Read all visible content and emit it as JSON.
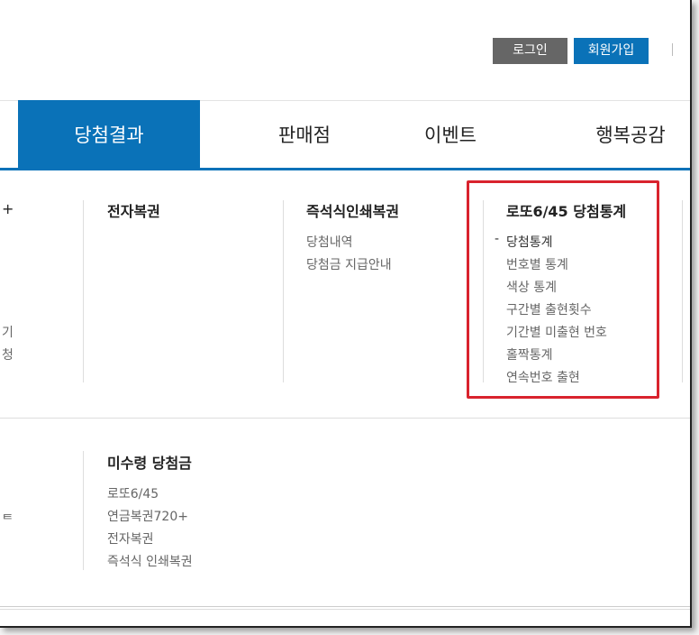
{
  "header": {
    "login_label": "로그인",
    "signup_label": "회원가입"
  },
  "nav": {
    "items": [
      "당첨결과",
      "판매점",
      "이벤트",
      "행복공감"
    ]
  },
  "menu": {
    "col_electronic": {
      "heading": "전자복권"
    },
    "col_instant": {
      "heading": "즉석식인쇄복권",
      "items": [
        "당첨내역",
        "당첨금 지급안내"
      ]
    },
    "col_stats": {
      "heading": "로또6/45 당첨통계",
      "dash": "-",
      "items": [
        "당첨통계",
        "번호별 통계",
        "색상 통계",
        "구간별 출현횟수",
        "기간별 미출현 번호",
        "홀짝통계",
        "연속번호 출현"
      ]
    },
    "col_minor": {
      "heading": "미수령 당첨금",
      "items": [
        "로또6/45",
        "연금복권720+",
        "전자복권",
        "즉석식 인쇄복권"
      ]
    },
    "left_fragments": [
      "기",
      "청"
    ]
  },
  "colors": {
    "accent": "#0a72b8",
    "highlight": "#d9232d"
  }
}
